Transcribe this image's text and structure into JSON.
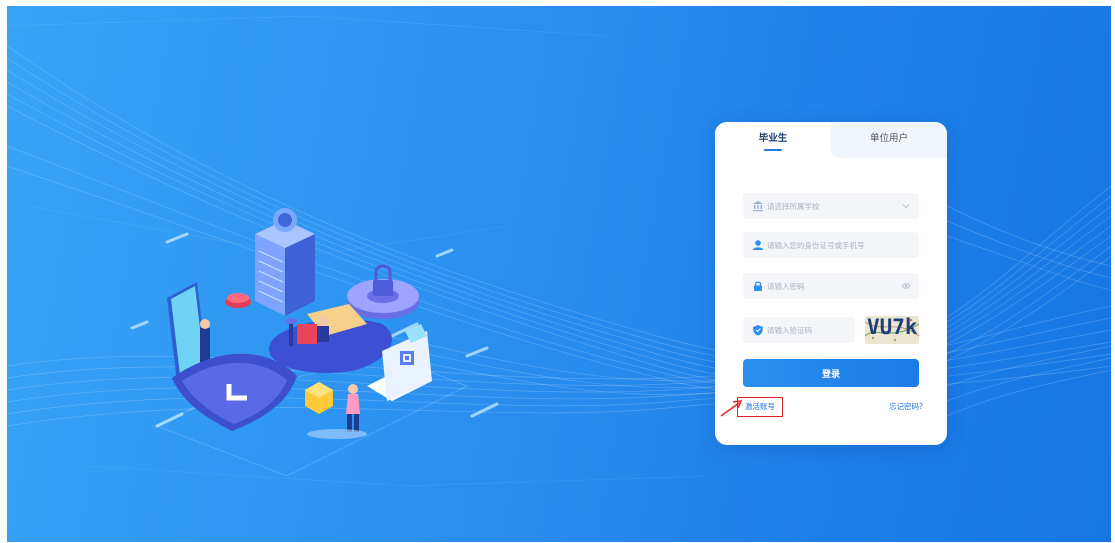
{
  "tabs": {
    "graduate": "毕业生",
    "unit_user": "单位用户"
  },
  "form": {
    "school_placeholder": "请选择所属学校",
    "id_placeholder": "请输入您的身份证号或手机号",
    "password_placeholder": "请输入密码",
    "captcha_placeholder": "请输入验证码",
    "captcha_code": "VU7k",
    "login_label": "登录",
    "activate_label": "激活账号",
    "forgot_label": "忘记密码?"
  },
  "colors": {
    "primary": "#1f7ae8",
    "highlight_box": "#e02424"
  },
  "icons": [
    "school-icon",
    "user-icon",
    "lock-icon",
    "shield-icon",
    "chevron-down-icon",
    "eye-icon",
    "arrow-icon"
  ]
}
